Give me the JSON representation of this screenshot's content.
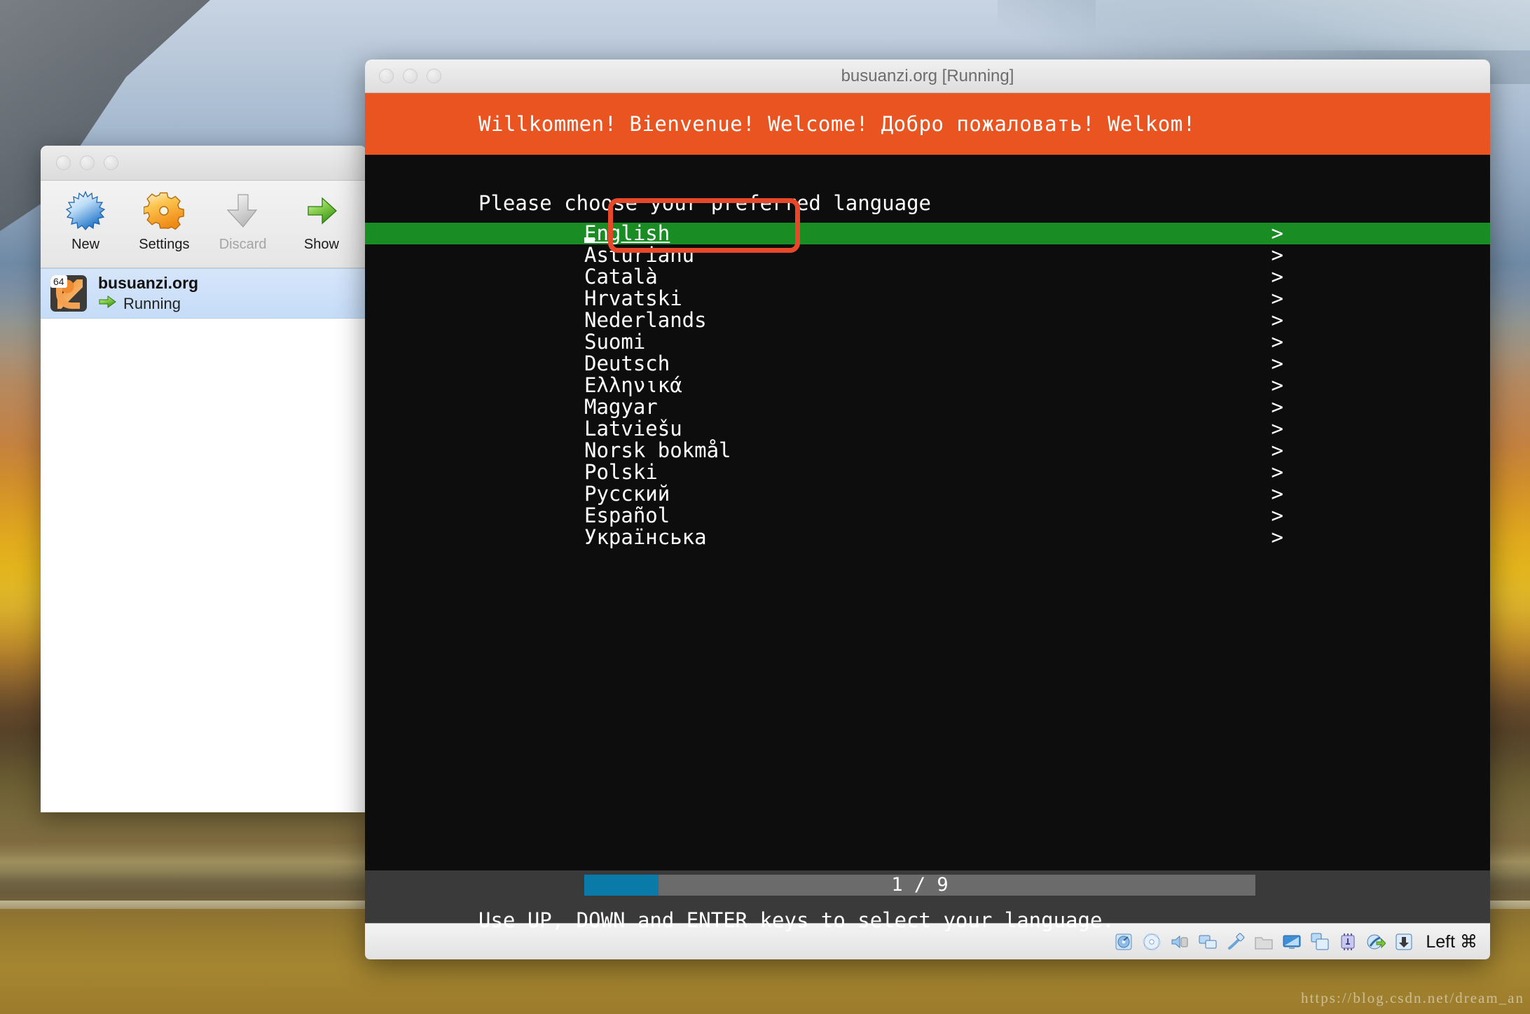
{
  "desktop": {
    "watermark": "https://blog.csdn.net/dream_an"
  },
  "manager_window": {
    "toolbar": [
      {
        "label": "New",
        "icon": "star-burst-icon",
        "enabled": true
      },
      {
        "label": "Settings",
        "icon": "gear-icon",
        "enabled": true
      },
      {
        "label": "Discard",
        "icon": "down-arrow-icon",
        "enabled": false
      },
      {
        "label": "Show",
        "icon": "green-arrow-icon",
        "enabled": true
      }
    ],
    "vm": {
      "name": "busuanzi.org",
      "state": "Running",
      "arch_badge": "64",
      "icon": "ubuntu-icon",
      "state_icon": "green-arrow-icon"
    }
  },
  "vm_window": {
    "title": "busuanzi.org [Running]",
    "welcome_banner": "Willkommen! Bienvenue! Welcome! Добро пожаловать! Welkom!",
    "accent_color": "#e95420",
    "prompt": "Please choose your preferred language",
    "languages": [
      {
        "name": "English",
        "selected": true
      },
      {
        "name": "Asturianu",
        "selected": false
      },
      {
        "name": "Català",
        "selected": false
      },
      {
        "name": "Hrvatski",
        "selected": false
      },
      {
        "name": "Nederlands",
        "selected": false
      },
      {
        "name": "Suomi",
        "selected": false
      },
      {
        "name": "Deutsch",
        "selected": false
      },
      {
        "name": "Ελληνικά",
        "selected": false
      },
      {
        "name": "Magyar",
        "selected": false
      },
      {
        "name": "Latviešu",
        "selected": false
      },
      {
        "name": "Norsk bokmål",
        "selected": false
      },
      {
        "name": "Polski",
        "selected": false
      },
      {
        "name": "Русский",
        "selected": false
      },
      {
        "name": "Español",
        "selected": false
      },
      {
        "name": "Українська",
        "selected": false
      }
    ],
    "chevron": ">",
    "progress": {
      "label": "1 / 9",
      "current": 1,
      "total": 9,
      "fill_color": "#0a7ba8",
      "track_color": "#6b6b6b"
    },
    "hint": "Use UP, DOWN and ENTER keys to select your language.",
    "selection_color": "#198c24",
    "statusbar": {
      "icons": [
        "hard-disk-icon",
        "optical-disk-icon",
        "audio-icon",
        "network-icon",
        "usb-icon",
        "shared-folder-icon",
        "display-icon",
        "snapshot-icon",
        "cpu-icon",
        "guest-additions-icon",
        "mouse-capture-icon"
      ],
      "host_key": "Left ⌘"
    }
  },
  "annotation": {
    "type": "highlight-box",
    "color": "#e8482a",
    "targets": "English"
  }
}
